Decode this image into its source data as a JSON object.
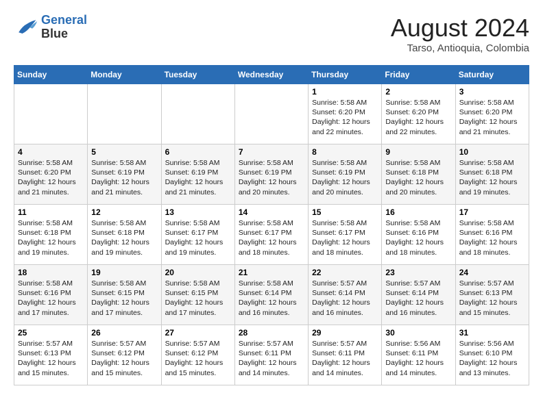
{
  "header": {
    "logo_line1": "General",
    "logo_line2": "Blue",
    "month_year": "August 2024",
    "location": "Tarso, Antioquia, Colombia"
  },
  "weekdays": [
    "Sunday",
    "Monday",
    "Tuesday",
    "Wednesday",
    "Thursday",
    "Friday",
    "Saturday"
  ],
  "weeks": [
    [
      {
        "day": "",
        "content": ""
      },
      {
        "day": "",
        "content": ""
      },
      {
        "day": "",
        "content": ""
      },
      {
        "day": "",
        "content": ""
      },
      {
        "day": "1",
        "content": "Sunrise: 5:58 AM\nSunset: 6:20 PM\nDaylight: 12 hours\nand 22 minutes."
      },
      {
        "day": "2",
        "content": "Sunrise: 5:58 AM\nSunset: 6:20 PM\nDaylight: 12 hours\nand 22 minutes."
      },
      {
        "day": "3",
        "content": "Sunrise: 5:58 AM\nSunset: 6:20 PM\nDaylight: 12 hours\nand 21 minutes."
      }
    ],
    [
      {
        "day": "4",
        "content": "Sunrise: 5:58 AM\nSunset: 6:20 PM\nDaylight: 12 hours\nand 21 minutes."
      },
      {
        "day": "5",
        "content": "Sunrise: 5:58 AM\nSunset: 6:19 PM\nDaylight: 12 hours\nand 21 minutes."
      },
      {
        "day": "6",
        "content": "Sunrise: 5:58 AM\nSunset: 6:19 PM\nDaylight: 12 hours\nand 21 minutes."
      },
      {
        "day": "7",
        "content": "Sunrise: 5:58 AM\nSunset: 6:19 PM\nDaylight: 12 hours\nand 20 minutes."
      },
      {
        "day": "8",
        "content": "Sunrise: 5:58 AM\nSunset: 6:19 PM\nDaylight: 12 hours\nand 20 minutes."
      },
      {
        "day": "9",
        "content": "Sunrise: 5:58 AM\nSunset: 6:18 PM\nDaylight: 12 hours\nand 20 minutes."
      },
      {
        "day": "10",
        "content": "Sunrise: 5:58 AM\nSunset: 6:18 PM\nDaylight: 12 hours\nand 19 minutes."
      }
    ],
    [
      {
        "day": "11",
        "content": "Sunrise: 5:58 AM\nSunset: 6:18 PM\nDaylight: 12 hours\nand 19 minutes."
      },
      {
        "day": "12",
        "content": "Sunrise: 5:58 AM\nSunset: 6:18 PM\nDaylight: 12 hours\nand 19 minutes."
      },
      {
        "day": "13",
        "content": "Sunrise: 5:58 AM\nSunset: 6:17 PM\nDaylight: 12 hours\nand 19 minutes."
      },
      {
        "day": "14",
        "content": "Sunrise: 5:58 AM\nSunset: 6:17 PM\nDaylight: 12 hours\nand 18 minutes."
      },
      {
        "day": "15",
        "content": "Sunrise: 5:58 AM\nSunset: 6:17 PM\nDaylight: 12 hours\nand 18 minutes."
      },
      {
        "day": "16",
        "content": "Sunrise: 5:58 AM\nSunset: 6:16 PM\nDaylight: 12 hours\nand 18 minutes."
      },
      {
        "day": "17",
        "content": "Sunrise: 5:58 AM\nSunset: 6:16 PM\nDaylight: 12 hours\nand 18 minutes."
      }
    ],
    [
      {
        "day": "18",
        "content": "Sunrise: 5:58 AM\nSunset: 6:16 PM\nDaylight: 12 hours\nand 17 minutes."
      },
      {
        "day": "19",
        "content": "Sunrise: 5:58 AM\nSunset: 6:15 PM\nDaylight: 12 hours\nand 17 minutes."
      },
      {
        "day": "20",
        "content": "Sunrise: 5:58 AM\nSunset: 6:15 PM\nDaylight: 12 hours\nand 17 minutes."
      },
      {
        "day": "21",
        "content": "Sunrise: 5:58 AM\nSunset: 6:14 PM\nDaylight: 12 hours\nand 16 minutes."
      },
      {
        "day": "22",
        "content": "Sunrise: 5:57 AM\nSunset: 6:14 PM\nDaylight: 12 hours\nand 16 minutes."
      },
      {
        "day": "23",
        "content": "Sunrise: 5:57 AM\nSunset: 6:14 PM\nDaylight: 12 hours\nand 16 minutes."
      },
      {
        "day": "24",
        "content": "Sunrise: 5:57 AM\nSunset: 6:13 PM\nDaylight: 12 hours\nand 15 minutes."
      }
    ],
    [
      {
        "day": "25",
        "content": "Sunrise: 5:57 AM\nSunset: 6:13 PM\nDaylight: 12 hours\nand 15 minutes."
      },
      {
        "day": "26",
        "content": "Sunrise: 5:57 AM\nSunset: 6:12 PM\nDaylight: 12 hours\nand 15 minutes."
      },
      {
        "day": "27",
        "content": "Sunrise: 5:57 AM\nSunset: 6:12 PM\nDaylight: 12 hours\nand 15 minutes."
      },
      {
        "day": "28",
        "content": "Sunrise: 5:57 AM\nSunset: 6:11 PM\nDaylight: 12 hours\nand 14 minutes."
      },
      {
        "day": "29",
        "content": "Sunrise: 5:57 AM\nSunset: 6:11 PM\nDaylight: 12 hours\nand 14 minutes."
      },
      {
        "day": "30",
        "content": "Sunrise: 5:56 AM\nSunset: 6:11 PM\nDaylight: 12 hours\nand 14 minutes."
      },
      {
        "day": "31",
        "content": "Sunrise: 5:56 AM\nSunset: 6:10 PM\nDaylight: 12 hours\nand 13 minutes."
      }
    ]
  ]
}
